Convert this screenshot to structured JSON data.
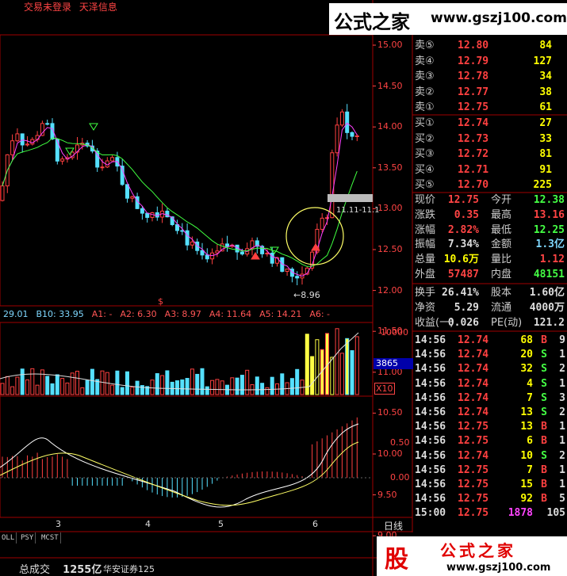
{
  "header": {
    "account_status": "交易未登录",
    "broker_name": "天泽信息"
  },
  "watermark": {
    "top_name": "公式之家",
    "top_url": "www.gszj100.com",
    "bottom_logo_char": "股",
    "bottom_name": "公式之家",
    "bottom_url": "www.gszj100.com"
  },
  "price_axis": [
    "15.00",
    "14.50",
    "14.00",
    "13.50",
    "13.00",
    "12.50",
    "12.00",
    "11.50",
    "11.00",
    "10.50",
    "10.00",
    "9.50",
    "9.00"
  ],
  "price_chart": {
    "price_range": [
      8.85,
      15.1
    ],
    "low_label": "8.96",
    "range_label": "11.11-11.1",
    "markers": [
      "$"
    ]
  },
  "indicator_bar": [
    {
      "text": "29.01",
      "color": "#7fd8ff"
    },
    {
      "text": "B10: 33.95",
      "color": "#7fd8ff"
    },
    {
      "text": "A1: -",
      "color": "#ff5555"
    },
    {
      "text": "A2: 6.30",
      "color": "#ff5555"
    },
    {
      "text": "A3: 8.97",
      "color": "#ff5555"
    },
    {
      "text": "A4: 11.64",
      "color": "#ff5555"
    },
    {
      "text": "A5: 14.21",
      "color": "#ff5555"
    },
    {
      "text": "A6: -",
      "color": "#ff5555"
    }
  ],
  "volume_axis": {
    "top": "10000",
    "current": "3865",
    "unit": "X10"
  },
  "macd_axis": [
    "0.50",
    "0.00"
  ],
  "date_axis": {
    "labels": [
      "3",
      "4",
      "5",
      "6"
    ],
    "period": "日线"
  },
  "bottom_tabs": [
    "OLL",
    "PSY",
    "MCST"
  ],
  "status_bar": {
    "total_label": "总成交",
    "total_value": "1255亿",
    "broker": "华安证券125"
  },
  "order_book": {
    "sell": [
      {
        "label": "卖⑤",
        "price": "12.80",
        "vol": "84"
      },
      {
        "label": "卖④",
        "price": "12.79",
        "vol": "127"
      },
      {
        "label": "卖③",
        "price": "12.78",
        "vol": "34"
      },
      {
        "label": "卖②",
        "price": "12.77",
        "vol": "38"
      },
      {
        "label": "卖①",
        "price": "12.75",
        "vol": "61"
      }
    ],
    "buy": [
      {
        "label": "买①",
        "price": "12.74",
        "vol": "27"
      },
      {
        "label": "买②",
        "price": "12.73",
        "vol": "33"
      },
      {
        "label": "买③",
        "price": "12.72",
        "vol": "81"
      },
      {
        "label": "买④",
        "price": "12.71",
        "vol": "91"
      },
      {
        "label": "买⑤",
        "price": "12.70",
        "vol": "225"
      }
    ]
  },
  "stats": [
    {
      "l1": "现价",
      "v1": "12.75",
      "c1": "#ff4444",
      "l2": "今开",
      "v2": "12.38",
      "c2": "#44ff44"
    },
    {
      "l1": "涨跌",
      "v1": "0.35",
      "c1": "#ff4444",
      "l2": "最高",
      "v2": "13.16",
      "c2": "#ff4444"
    },
    {
      "l1": "涨幅",
      "v1": "2.82%",
      "c1": "#ff4444",
      "l2": "最低",
      "v2": "12.25",
      "c2": "#44ff44"
    },
    {
      "l1": "振幅",
      "v1": "7.34%",
      "c1": "#dddddd",
      "l2": "金额",
      "v2": "1.3亿",
      "c2": "#7fd8ff"
    },
    {
      "l1": "总量",
      "v1": "10.6万",
      "c1": "#ffff00",
      "l2": "量比",
      "v2": "1.12",
      "c2": "#ff4444"
    },
    {
      "l1": "外盘",
      "v1": "57487",
      "c1": "#ff4444",
      "l2": "内盘",
      "v2": "48151",
      "c2": "#44ff44"
    }
  ],
  "stats2": [
    {
      "l1": "换手",
      "v1": "26.41%",
      "l2": "股本",
      "v2": "1.60亿"
    },
    {
      "l1": "净资",
      "v1": "5.29",
      "l2": "流通",
      "v2": "4000万"
    },
    {
      "l1": "收益(一)",
      "v1": "0.026",
      "l2": "PE(动)",
      "v2": "121.2"
    }
  ],
  "trades": [
    {
      "time": "14:56",
      "price": "12.74",
      "vol": "68",
      "side": "B",
      "n": "9"
    },
    {
      "time": "14:56",
      "price": "12.74",
      "vol": "20",
      "side": "S",
      "n": "1"
    },
    {
      "time": "14:56",
      "price": "12.74",
      "vol": "32",
      "side": "S",
      "n": "2"
    },
    {
      "time": "14:56",
      "price": "12.74",
      "vol": "4",
      "side": "S",
      "n": "1"
    },
    {
      "time": "14:56",
      "price": "12.74",
      "vol": "7",
      "side": "S",
      "n": "3"
    },
    {
      "time": "14:56",
      "price": "12.74",
      "vol": "13",
      "side": "S",
      "n": "2"
    },
    {
      "time": "14:56",
      "price": "12.75",
      "vol": "13",
      "side": "B",
      "n": "1"
    },
    {
      "time": "14:56",
      "price": "12.75",
      "vol": "6",
      "side": "B",
      "n": "1"
    },
    {
      "time": "14:56",
      "price": "12.74",
      "vol": "10",
      "side": "S",
      "n": "2"
    },
    {
      "time": "14:56",
      "price": "12.75",
      "vol": "7",
      "side": "B",
      "n": "1"
    },
    {
      "time": "14:56",
      "price": "12.75",
      "vol": "15",
      "side": "B",
      "n": "1"
    },
    {
      "time": "14:56",
      "price": "12.75",
      "vol": "92",
      "side": "B",
      "n": "5"
    },
    {
      "time": "15:00",
      "price": "12.75",
      "vol": "1878",
      "side": "",
      "n": "105"
    }
  ],
  "colors": {
    "up": "#ff4040",
    "down": "#55e0ff",
    "ma_short": "#ff40ff",
    "ma_long": "#40ff40",
    "grid": "#800000"
  }
}
